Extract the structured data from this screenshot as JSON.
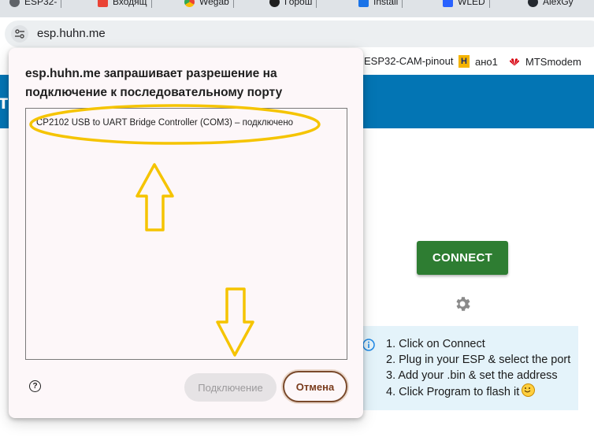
{
  "tabs": [
    {
      "label": "ESP32-",
      "icon": "globe-icon"
    },
    {
      "label": "Входящ",
      "icon": "gmail-icon"
    },
    {
      "label": "Wegab",
      "icon": "chrome-icon"
    },
    {
      "label": "Горош",
      "icon": "gear-icon"
    },
    {
      "label": "Install",
      "icon": "check-icon"
    },
    {
      "label": "WLED",
      "icon": "wled-icon"
    },
    {
      "label": "AlexGy",
      "icon": "github-icon"
    }
  ],
  "address_bar": {
    "url": "esp.huhn.me"
  },
  "bookmarks": [
    {
      "label": "ESP32-CAM-pinout"
    },
    {
      "label": "ано1",
      "icon_text": "H"
    },
    {
      "label": "MTSmodem"
    }
  ],
  "page": {
    "header_fragment": "т",
    "connect_label": "CONNECT",
    "steps": [
      "1. Click on Connect",
      "2. Plug in your ESP & select the port",
      "3. Add your .bin & set the address",
      "4. Click Program to flash it"
    ]
  },
  "dialog": {
    "title": "esp.huhn.me запрашивает разрешение на подключение к последовательному порту",
    "ports": [
      {
        "label": "CP2102 USB to UART Bridge Controller (COM3) – подключено"
      }
    ],
    "help_glyph": "?",
    "connect_label": "Подключение",
    "cancel_label": "Отмена"
  },
  "colors": {
    "header_blue": "#0375b4",
    "connect_green": "#2e7d32",
    "info_bg": "#e4f3fa",
    "annotation_yellow": "#f5c400",
    "cancel_brown": "#7a4a2c"
  }
}
